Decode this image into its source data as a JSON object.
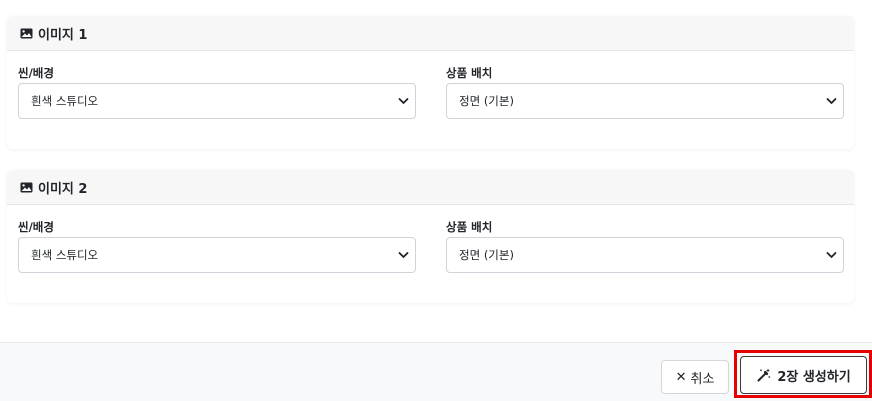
{
  "cards": [
    {
      "title": "이미지 1",
      "scene_label": "씬/배경",
      "scene_value": "흰색 스튜디오",
      "placement_label": "상품 배치",
      "placement_value": "정면 (기본)"
    },
    {
      "title": "이미지 2",
      "scene_label": "씬/배경",
      "scene_value": "흰색 스튜디오",
      "placement_label": "상품 배치",
      "placement_value": "정면 (기본)"
    }
  ],
  "footer": {
    "cancel_icon": "✕",
    "cancel_label": "취소",
    "generate_label": "2장 생성하기"
  },
  "colors": {
    "highlight": "#e60000",
    "header_bg": "#f7f7f7",
    "footer_bg": "#f8f9fa"
  }
}
